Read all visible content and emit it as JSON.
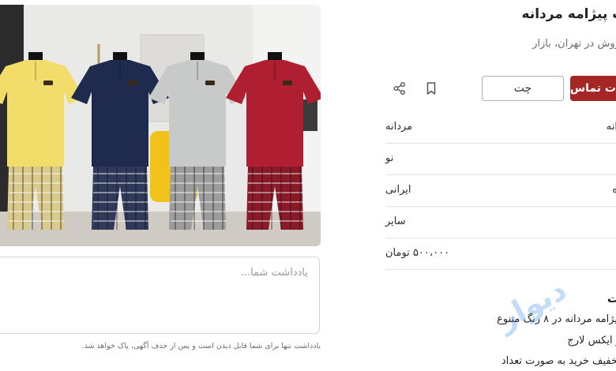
{
  "product": {
    "title": "ست پیژامه مردانه",
    "location": "فروش در تهران، بازار"
  },
  "actions": {
    "contact_label": "ت تماس",
    "chat_label": "چت",
    "bookmark_icon": "bookmark-icon",
    "share_icon": "share-icon"
  },
  "details": [
    {
      "key": "انه",
      "value": "مردانه"
    },
    {
      "key": "",
      "value": "نو"
    },
    {
      "key": "ه",
      "value": "ایرانی"
    },
    {
      "key": "",
      "value": "سایر"
    },
    {
      "key": "",
      "value": "۵۰۰،۰۰۰ تومان"
    }
  ],
  "description": {
    "heading": "ت",
    "lines": [
      "پیژامه مردانه در ۸ رنگ متنوع",
      "و ایکس لارج",
      "تخفیف خرید به صورت تعداد"
    ]
  },
  "note": {
    "placeholder": "یادداشت شما...",
    "value": "",
    "hint": "یادداشت تنها برای شما قابل دیدن است و پس از حذف آگهی، پاک خواهد شد."
  },
  "image": {
    "shirt_colors": [
      "#f2dc6a",
      "#1e2a4e",
      "#c8c9c9",
      "#b01e32"
    ]
  },
  "watermark": "دیوار"
}
